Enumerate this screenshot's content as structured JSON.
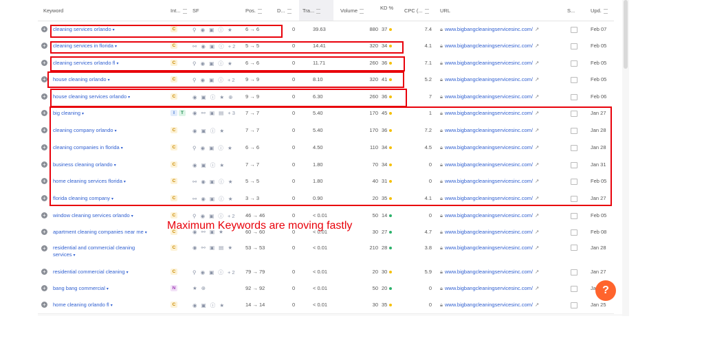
{
  "columns": {
    "keyword": "Keyword",
    "intent": "Int...",
    "sf": "SF",
    "pos": "Pos.",
    "diff": "D...",
    "traffic": "Tra...",
    "volume": "Volume",
    "kd": "KD %",
    "cpc": "CPC (...",
    "url": "URL",
    "serp": "S...",
    "updated": "Upd."
  },
  "rows": [
    {
      "keyword": "cleaning services orlando",
      "intent": [
        "C"
      ],
      "sf": "⚲ ◉ ▣ ⓘ ★",
      "pos": "6 → 6",
      "diff": "0",
      "traffic": "39.63",
      "volume": "880",
      "kd": "37",
      "kd_color": "#f5c000",
      "cpc": "7.4",
      "url": "www.bigbangcleaningservicesinc.com/",
      "updated": "Feb 07"
    },
    {
      "keyword": "cleaning services in florida",
      "intent": [
        "C"
      ],
      "sf": "⚯ ◉ ▣ ⓘ +2",
      "pos": "5 → 5",
      "diff": "0",
      "traffic": "14.41",
      "volume": "320",
      "kd": "34",
      "kd_color": "#f5c000",
      "cpc": "4.1",
      "url": "www.bigbangcleaningservicesinc.com/",
      "updated": "Feb 05"
    },
    {
      "keyword": "cleaning services orlando fl",
      "intent": [
        "C"
      ],
      "sf": "⚲ ◉ ▣ ⓘ ★",
      "pos": "6 → 6",
      "diff": "0",
      "traffic": "11.71",
      "volume": "260",
      "kd": "36",
      "kd_color": "#f5c000",
      "cpc": "7.1",
      "url": "www.bigbangcleaningservicesinc.com/",
      "updated": "Feb 05"
    },
    {
      "keyword": "house cleaning orlando",
      "intent": [
        "C"
      ],
      "sf": "⚲ ◉ ▣ ⓘ +2",
      "pos": "9 → 9",
      "diff": "0",
      "traffic": "8.10",
      "volume": "320",
      "kd": "41",
      "kd_color": "#f5c000",
      "cpc": "5.2",
      "url": "www.bigbangcleaningservicesinc.com/",
      "updated": "Feb 05"
    },
    {
      "keyword": "house cleaning services orlando",
      "intent": [
        "C"
      ],
      "sf": "◉ ▣ ⓘ ★ ⊕",
      "pos": "9 → 9",
      "diff": "0",
      "traffic": "6.30",
      "volume": "260",
      "kd": "36",
      "kd_color": "#f5c000",
      "cpc": "7",
      "url": "www.bigbangcleaningservicesinc.com/",
      "updated": "Feb 06"
    },
    {
      "keyword": "big cleaning",
      "intent": [
        "I",
        "T"
      ],
      "sf": "◉ ⚯ ▣ ▤ +3",
      "pos": "7 → 7",
      "diff": "0",
      "traffic": "5.40",
      "volume": "170",
      "kd": "45",
      "kd_color": "#f5c000",
      "cpc": "1",
      "url": "www.bigbangcleaningservicesinc.com/",
      "updated": "Jan 27"
    },
    {
      "keyword": "cleaning company orlando",
      "intent": [
        "C"
      ],
      "sf": "◉ ▣ ⓘ ★",
      "pos": "7 → 7",
      "diff": "0",
      "traffic": "5.40",
      "volume": "170",
      "kd": "36",
      "kd_color": "#f5c000",
      "cpc": "7.2",
      "url": "www.bigbangcleaningservicesinc.com/",
      "updated": "Jan 28"
    },
    {
      "keyword": "cleaning companies in florida",
      "intent": [
        "C"
      ],
      "sf": "⚲ ◉ ▣ ⓘ ★",
      "pos": "6 → 6",
      "diff": "0",
      "traffic": "4.50",
      "volume": "110",
      "kd": "34",
      "kd_color": "#f5c000",
      "cpc": "4.5",
      "url": "www.bigbangcleaningservicesinc.com/",
      "updated": "Jan 28"
    },
    {
      "keyword": "business cleaning orlando",
      "intent": [
        "C"
      ],
      "sf": "◉ ▣ ⓘ ★",
      "pos": "7 → 7",
      "diff": "0",
      "traffic": "1.80",
      "volume": "70",
      "kd": "34",
      "kd_color": "#f5c000",
      "cpc": "0",
      "url": "www.bigbangcleaningservicesinc.com/",
      "updated": "Jan 31"
    },
    {
      "keyword": "home cleaning services florida",
      "intent": [
        "C"
      ],
      "sf": "⚯ ◉ ▣ ⓘ ★",
      "pos": "5 → 5",
      "diff": "0",
      "traffic": "1.80",
      "volume": "40",
      "kd": "31",
      "kd_color": "#f5c000",
      "cpc": "0",
      "url": "www.bigbangcleaningservicesinc.com/",
      "updated": "Feb 05"
    },
    {
      "keyword": "florida cleaning company",
      "intent": [
        "C"
      ],
      "sf": "⚯ ◉ ▣ ⓘ ★",
      "pos": "3 → 3",
      "diff": "0",
      "traffic": "0.90",
      "volume": "20",
      "kd": "35",
      "kd_color": "#f5c000",
      "cpc": "4.1",
      "url": "www.bigbangcleaningservicesinc.com/",
      "updated": "Jan 27"
    },
    {
      "keyword": "window cleaning services orlando",
      "intent": [
        "C"
      ],
      "sf": "⚲ ◉ ▣ ⓘ +2",
      "pos": "46 → 46",
      "diff": "0",
      "traffic": "< 0.01",
      "volume": "50",
      "kd": "14",
      "kd_color": "#2cb26b",
      "cpc": "0",
      "url": "www.bigbangcleaningservicesinc.com/",
      "updated": "Feb 05"
    },
    {
      "keyword": "apartment cleaning companies near me",
      "intent": [
        "C"
      ],
      "sf": "◉ ⚯ ▣ ★",
      "pos": "60 → 60",
      "diff": "0",
      "traffic": "< 0.01",
      "volume": "30",
      "kd": "27",
      "kd_color": "#2cb26b",
      "cpc": "4.7",
      "url": "www.bigbangcleaningservicesinc.com/",
      "updated": "Feb 08"
    },
    {
      "keyword": "residential and commercial cleaning services",
      "intent": [
        "C"
      ],
      "sf": "◉ ⚯ ▣ ▤ ★",
      "pos": "53 → 53",
      "diff": "0",
      "traffic": "< 0.01",
      "volume": "210",
      "kd": "28",
      "kd_color": "#2cb26b",
      "cpc": "3.8",
      "url": "www.bigbangcleaningservicesinc.com/",
      "updated": "Jan 28"
    },
    {
      "keyword": "residential commercial cleaning",
      "intent": [
        "C"
      ],
      "sf": "⚲ ◉ ▣ ⓘ +2",
      "pos": "79 → 79",
      "diff": "0",
      "traffic": "< 0.01",
      "volume": "20",
      "kd": "30",
      "kd_color": "#f5c000",
      "cpc": "5.9",
      "url": "www.bigbangcleaningservicesinc.com/",
      "updated": "Jan 27"
    },
    {
      "keyword": "bang bang commercial",
      "intent": [
        "N"
      ],
      "sf": "★ ⊕",
      "pos": "92 → 92",
      "diff": "0",
      "traffic": "< 0.01",
      "volume": "50",
      "kd": "20",
      "kd_color": "#2cb26b",
      "cpc": "0",
      "url": "www.bigbangcleaningservicesinc.com/",
      "updated": "Jan 27"
    },
    {
      "keyword": "home cleaning orlando fl",
      "intent": [
        "C"
      ],
      "sf": "◉ ▣ ⓘ ★",
      "pos": "14 → 14",
      "diff": "0",
      "traffic": "< 0.01",
      "volume": "30",
      "kd": "35",
      "kd_color": "#f5c000",
      "cpc": "0",
      "url": "www.bigbangcleaningservicesinc.com/",
      "updated": "Jan 25"
    }
  ],
  "annotation": "Maximum Keywords are moving fastly",
  "help_button": "?"
}
